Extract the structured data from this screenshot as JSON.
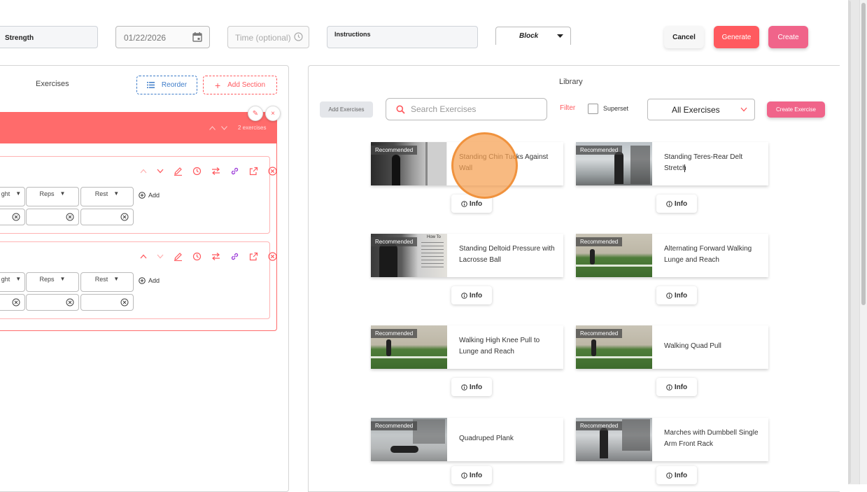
{
  "header": {
    "category_value": "Strength",
    "date_value": "01/22/2026",
    "time_placeholder": "Time (optional)",
    "instructions_label": "Instructions",
    "type_value": "Block",
    "cancel_label": "Cancel",
    "generate_label": "Generate",
    "create_label": "Create"
  },
  "left": {
    "title": "Exercises",
    "reorder_label": "Reorder",
    "add_section_label": "Add Section",
    "section_count": "2 exercises",
    "exercises": [
      {
        "columns": [
          "ght",
          "Reps",
          "Rest"
        ],
        "add_label": "Add"
      },
      {
        "columns": [
          "ght",
          "Reps",
          "Rest"
        ],
        "add_label": "Add"
      }
    ]
  },
  "library": {
    "title": "Library",
    "add_exercises_label": "Add Exercises",
    "search_placeholder": "Search Exercises",
    "filter_label": "Filter",
    "superset_label": "Superset",
    "category_select": "All Exercises",
    "create_exercise_label": "Create Exercise",
    "badge": "Recommended",
    "info_label": "Info",
    "cards": [
      {
        "title": "Standing Chin Tucks Against Wall"
      },
      {
        "title": "Standing Teres-Rear Delt Stretch"
      },
      {
        "title": "Standing Deltoid Pressure with Lacrosse Ball"
      },
      {
        "title": "Alternating Forward Walking Lunge and Reach"
      },
      {
        "title": "Walking High Knee Pull to Lunge and Reach"
      },
      {
        "title": "Walking Quad Pull"
      },
      {
        "title": "Quadruped Plank"
      },
      {
        "title": "Marches with Dumbbell Single Arm Front Rack"
      }
    ],
    "thumb_text": "How To"
  },
  "colors": {
    "accent_red": "#ff5a5f",
    "accent_pink": "#f0648a",
    "section_red": "#ff6b6b",
    "reorder_blue": "#3d7cc9",
    "highlight_orange": "#f0a050"
  }
}
